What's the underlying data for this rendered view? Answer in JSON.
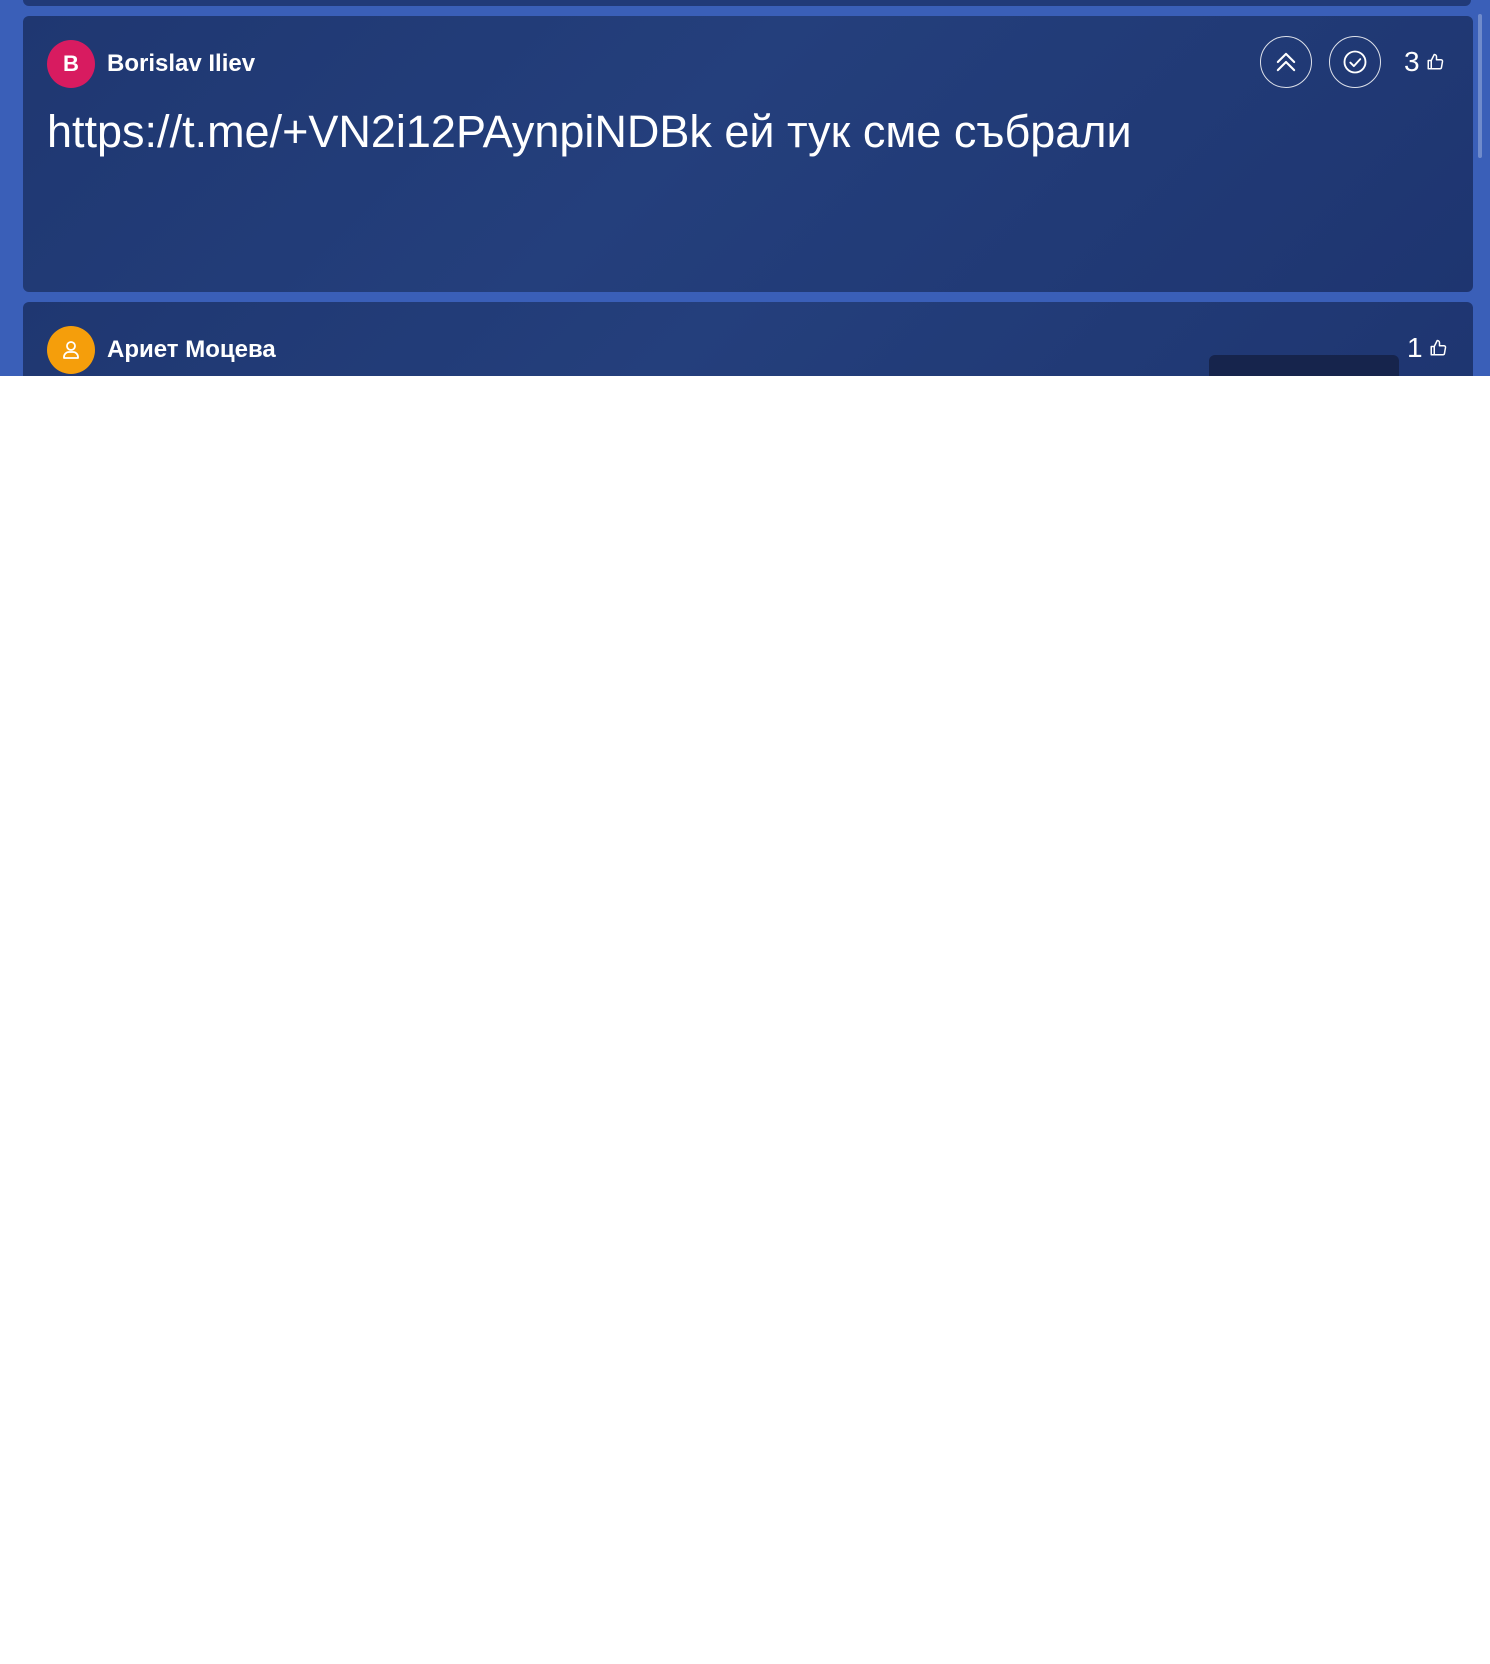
{
  "messages": [
    {
      "author": "Borislav Iliev",
      "avatar_initial": "B",
      "avatar_color": "#d81b60",
      "text": "https://t.me/+VN2i12PAynpiNDBk ей тук сме събрали",
      "likes": "3",
      "actions": [
        "upvote",
        "mark-answered"
      ]
    },
    {
      "author": "Ариет Моцева",
      "avatar_icon": "user-icon",
      "avatar_color": "#f59e0b",
      "likes": "1"
    }
  ],
  "colors": {
    "page_background": "#3a5fb8",
    "card_background": "#213a78",
    "text": "#ffffff"
  }
}
